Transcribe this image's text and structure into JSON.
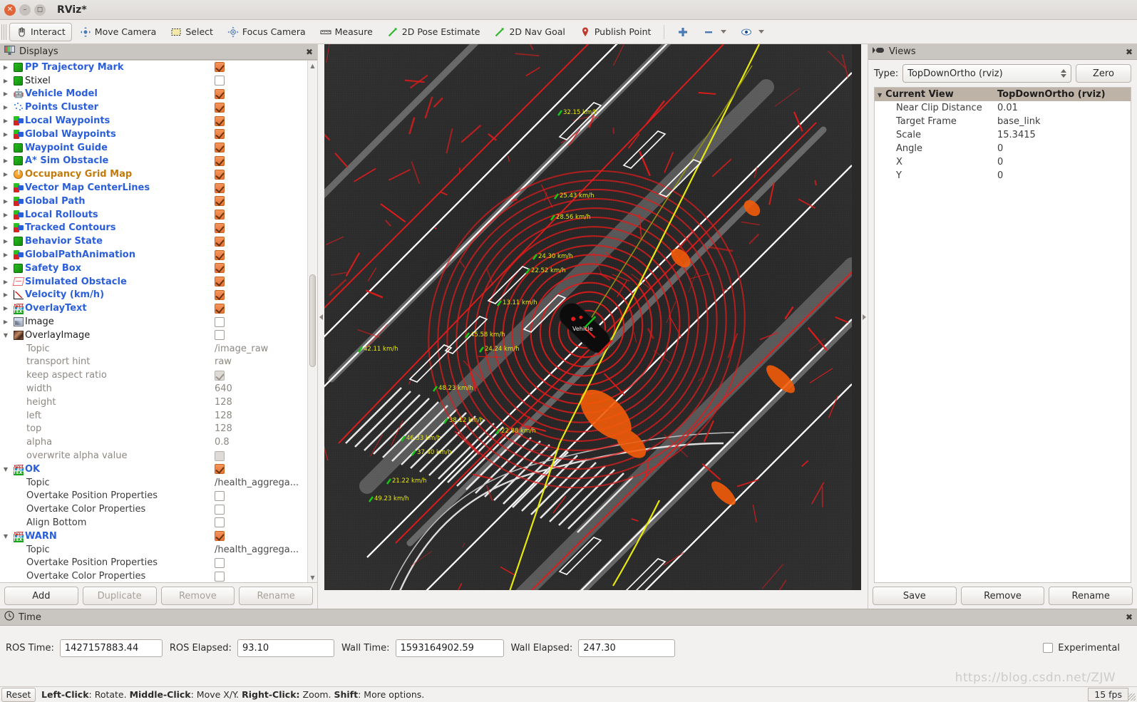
{
  "window": {
    "title": "RViz*",
    "close_icon": "close-icon",
    "minimize_icon": "minimize-icon",
    "maximize_icon": "maximize-icon"
  },
  "toolbar": {
    "items": [
      {
        "label": "Interact",
        "icon": "hand-pointer-icon",
        "active": true
      },
      {
        "label": "Move Camera",
        "icon": "move-camera-icon",
        "active": false
      },
      {
        "label": "Select",
        "icon": "select-rectangle-icon",
        "active": false
      },
      {
        "label": "Focus Camera",
        "icon": "focus-camera-icon",
        "active": false
      },
      {
        "label": "Measure",
        "icon": "ruler-icon",
        "active": false
      },
      {
        "label": "2D Pose Estimate",
        "icon": "pose-arrow-icon",
        "active": false
      },
      {
        "label": "2D Nav Goal",
        "icon": "nav-goal-arrow-icon",
        "active": false
      },
      {
        "label": "Publish Point",
        "icon": "map-pin-icon",
        "active": false
      }
    ],
    "extra": [
      {
        "icon": "plus-icon"
      },
      {
        "icon": "minus-icon",
        "dropdown": true
      },
      {
        "icon": "eye-icon",
        "dropdown": true
      }
    ]
  },
  "displays": {
    "title": "Displays",
    "panel_icon": "displays-icon",
    "close_icon": "close-icon",
    "tree": [
      {
        "label": "PP Trajectory Mark",
        "kind": "display",
        "icon": "green-cube-icon",
        "style": "blue",
        "checked": true,
        "expandable": true
      },
      {
        "label": "Stixel",
        "kind": "display",
        "icon": "green-cube-icon",
        "style": "black",
        "checked": false,
        "expandable": true
      },
      {
        "label": "Vehicle Model",
        "kind": "display",
        "icon": "robot-model-icon",
        "style": "blue",
        "checked": true,
        "expandable": true
      },
      {
        "label": "Points Cluster",
        "kind": "display",
        "icon": "point-cloud-icon",
        "style": "blue",
        "checked": true,
        "expandable": true
      },
      {
        "label": "Local Waypoints",
        "kind": "display",
        "icon": "marker-array-icon",
        "style": "blue",
        "checked": true,
        "expandable": true
      },
      {
        "label": "Global Waypoints",
        "kind": "display",
        "icon": "marker-array-icon",
        "style": "blue",
        "checked": true,
        "expandable": true
      },
      {
        "label": "Waypoint Guide",
        "kind": "display",
        "icon": "green-cube-icon",
        "style": "blue",
        "checked": true,
        "expandable": true
      },
      {
        "label": "A* Sim Obstacle",
        "kind": "display",
        "icon": "green-cube-icon",
        "style": "blue",
        "checked": true,
        "expandable": true
      },
      {
        "label": "Occupancy Grid Map",
        "kind": "display",
        "icon": "warning-circle-icon",
        "style": "orange",
        "checked": true,
        "expandable": true
      },
      {
        "label": "Vector Map CenterLines",
        "kind": "display",
        "icon": "marker-array-icon",
        "style": "blue",
        "checked": true,
        "expandable": true
      },
      {
        "label": "Global Path",
        "kind": "display",
        "icon": "marker-array-icon",
        "style": "blue",
        "checked": true,
        "expandable": true
      },
      {
        "label": "Local Rollouts",
        "kind": "display",
        "icon": "marker-array-icon",
        "style": "blue",
        "checked": true,
        "expandable": true
      },
      {
        "label": "Tracked Contours",
        "kind": "display",
        "icon": "marker-array-icon",
        "style": "blue",
        "checked": true,
        "expandable": true
      },
      {
        "label": "Behavior State",
        "kind": "display",
        "icon": "green-cube-icon",
        "style": "blue",
        "checked": true,
        "expandable": true
      },
      {
        "label": "GlobalPathAnimation",
        "kind": "display",
        "icon": "marker-array-icon",
        "style": "blue",
        "checked": true,
        "expandable": true
      },
      {
        "label": "Safety Box",
        "kind": "display",
        "icon": "green-cube-icon",
        "style": "blue",
        "checked": true,
        "expandable": true
      },
      {
        "label": "Simulated Obstacle",
        "kind": "display",
        "icon": "wireframe-box-icon",
        "style": "blue",
        "checked": true,
        "expandable": true
      },
      {
        "label": "Velocity (km/h)",
        "kind": "display",
        "icon": "plot-icon",
        "style": "blue",
        "checked": true,
        "expandable": true
      },
      {
        "label": "OverlayText",
        "kind": "display",
        "icon": "overlay-text-icon",
        "style": "blue",
        "checked": true,
        "expandable": true
      },
      {
        "label": "Image",
        "kind": "display",
        "icon": "image-icon",
        "style": "black",
        "checked": false,
        "expandable": true
      },
      {
        "label": "OverlayImage",
        "kind": "display",
        "icon": "overlay-image-icon",
        "style": "black",
        "checked": false,
        "expandable": true,
        "expanded": true
      },
      {
        "label": "Topic",
        "kind": "prop",
        "value": "/image_raw"
      },
      {
        "label": "transport hint",
        "kind": "prop",
        "value": "raw"
      },
      {
        "label": "keep aspect ratio",
        "kind": "propcheck",
        "checkstate": "disabled-checked"
      },
      {
        "label": "width",
        "kind": "prop",
        "value": "640"
      },
      {
        "label": "height",
        "kind": "prop",
        "value": "128"
      },
      {
        "label": "left",
        "kind": "prop",
        "value": "128"
      },
      {
        "label": "top",
        "kind": "prop",
        "value": "128"
      },
      {
        "label": "alpha",
        "kind": "prop",
        "value": "0.8"
      },
      {
        "label": "overwrite alpha value",
        "kind": "propcheck",
        "checkstate": "disabled-unchecked"
      },
      {
        "label": "OK",
        "kind": "display",
        "icon": "overlay-text-icon",
        "style": "blue",
        "checked": true,
        "expandable": true,
        "expanded": true
      },
      {
        "label": "Topic",
        "kind": "propdark",
        "value": "/health_aggrega..."
      },
      {
        "label": "Overtake Position Properties",
        "kind": "propdarkcheck",
        "checkstate": "unchecked"
      },
      {
        "label": "Overtake Color Properties",
        "kind": "propdarkcheck",
        "checkstate": "unchecked"
      },
      {
        "label": "Align Bottom",
        "kind": "propdarkcheck",
        "checkstate": "unchecked"
      },
      {
        "label": "WARN",
        "kind": "display",
        "icon": "overlay-text-icon",
        "style": "blue",
        "checked": true,
        "expandable": true,
        "expanded": true
      },
      {
        "label": "Topic",
        "kind": "propdark",
        "value": "/health_aggrega..."
      },
      {
        "label": "Overtake Position Properties",
        "kind": "propdarkcheck",
        "checkstate": "unchecked"
      },
      {
        "label": "Overtake Color Properties",
        "kind": "propdarkcheck",
        "checkstate": "unchecked"
      }
    ],
    "buttons": [
      {
        "label": "Add",
        "enabled": true
      },
      {
        "label": "Duplicate",
        "enabled": false
      },
      {
        "label": "Remove",
        "enabled": false
      },
      {
        "label": "Rename",
        "enabled": false
      }
    ]
  },
  "views": {
    "title": "Views",
    "panel_icon": "views-camera-icon",
    "close_icon": "close-icon",
    "type_label": "Type:",
    "type_value": "TopDownOrtho (rviz)",
    "zero_label": "Zero",
    "tree_header": {
      "key": "Current View",
      "value": "TopDownOrtho (rviz)"
    },
    "rows": [
      {
        "key": "Near Clip Distance",
        "value": "0.01"
      },
      {
        "key": "Target Frame",
        "value": "base_link"
      },
      {
        "key": "Scale",
        "value": "15.3415"
      },
      {
        "key": "Angle",
        "value": "0"
      },
      {
        "key": "X",
        "value": "0"
      },
      {
        "key": "Y",
        "value": "0"
      }
    ],
    "buttons": [
      {
        "label": "Save"
      },
      {
        "label": "Remove"
      },
      {
        "label": "Rename"
      }
    ]
  },
  "viewport": {
    "velocity_labels": [
      "32.15 km/h",
      "25.43 km/h",
      "28.56 km/h",
      "24.30 km/h",
      "22.52 km/h",
      "13.11 km/h",
      "45.58 km/h",
      "24.24 km/h",
      "48.23 km/h",
      "38.12 km/h",
      "46.33 km/h",
      "37.40 km/h",
      "21.22 km/h",
      "49.23 km/h",
      "42.11 km/h",
      "22.88 km/h"
    ],
    "vehicle_label": "Vehicle",
    "left_handle_icon": "collapse-left-icon",
    "right_handle_icon": "collapse-right-icon"
  },
  "time": {
    "title": "Time",
    "clock_icon": "clock-icon",
    "close_icon": "close-icon",
    "fields": [
      {
        "label": "ROS Time:",
        "value": "1427157883.44"
      },
      {
        "label": "ROS Elapsed:",
        "value": "93.10"
      },
      {
        "label": "Wall Time:",
        "value": "1593164902.59"
      },
      {
        "label": "Wall Elapsed:",
        "value": "247.30"
      }
    ],
    "experimental_label": "Experimental",
    "experimental_checked": false
  },
  "statusbar": {
    "reset_label": "Reset",
    "hint_parts": [
      {
        "text": "Left-Click",
        "bold": true
      },
      {
        "text": ": Rotate. ",
        "bold": false
      },
      {
        "text": "Middle-Click",
        "bold": true
      },
      {
        "text": ": Move X/Y. ",
        "bold": false
      },
      {
        "text": "Right-Click:",
        "bold": true
      },
      {
        "text": " Zoom. ",
        "bold": false
      },
      {
        "text": "Shift",
        "bold": true
      },
      {
        "text": ": More options.",
        "bold": false
      }
    ],
    "fps": "15 fps",
    "watermark": "https://blog.csdn.net/ZJW"
  },
  "colors": {
    "accent_checkbox": "#ea7438",
    "label_blue": "#2b5fd9",
    "label_orange": "#c47a0a",
    "panel_header": "#c9c5c0",
    "viewport_bg": "#2a2a2a",
    "lidar_red": "#e01b1b",
    "path_yellow": "#e8e80f",
    "lane_white": "#ffffff",
    "velocity_text": "#e8e80f"
  }
}
